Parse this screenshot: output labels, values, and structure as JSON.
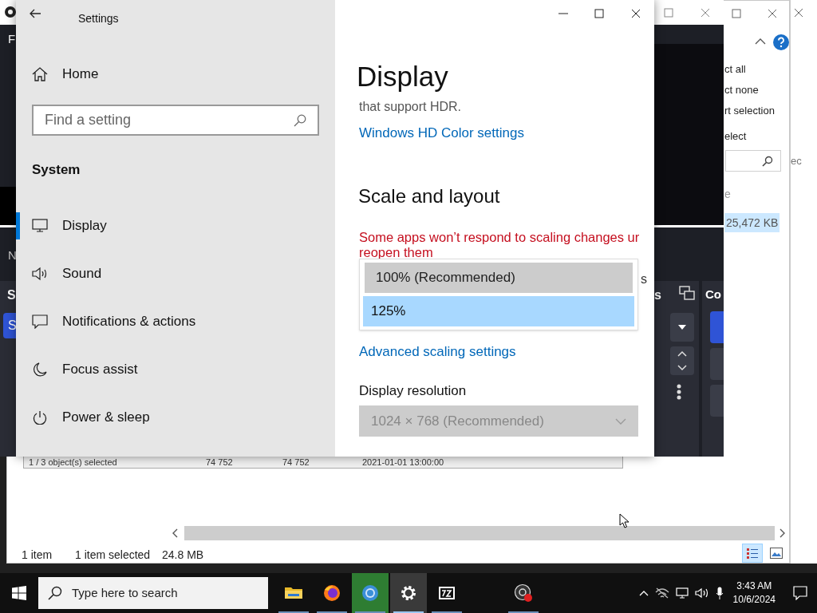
{
  "dark_window": {
    "menu_fragment": "F",
    "side_fragments": [
      "N",
      "S",
      "S"
    ],
    "panel_fragments": [
      "s",
      "Co"
    ]
  },
  "explorer_window": {
    "ribbon_items": [
      "ct all",
      "ct none",
      "rt selection",
      "elect"
    ],
    "list_fragment": "e",
    "size_cell": {
      "text": "25,472 KB",
      "selected": true
    },
    "inner_table": [
      "1 / 3 object(s) selected",
      "74 752",
      "74 752",
      "2021-01-01 13:00:00"
    ],
    "status_bar": {
      "count": "1 item",
      "selection": "1 item selected",
      "size": "24.8 MB"
    },
    "view_buttons": [
      {
        "kind": "details",
        "selected": true
      },
      {
        "kind": "thumbnails",
        "selected": false
      }
    ]
  },
  "edge_window": {
    "text_fragment": "ec"
  },
  "settings": {
    "title": "Settings",
    "home": "Home",
    "search": {
      "placeholder": "Find a setting"
    },
    "section": "System",
    "nav_items": [
      {
        "label": "Display",
        "selected": true
      },
      {
        "label": "Sound",
        "selected": false
      },
      {
        "label": "Notifications & actions",
        "selected": false
      },
      {
        "label": "Focus assist",
        "selected": false
      },
      {
        "label": "Power & sleep",
        "selected": false
      }
    ],
    "page_title": "Display",
    "hdr_text": "that support HDR.",
    "hdr_link": "Windows HD Color settings",
    "scale_heading": "Scale and layout",
    "warning": "Some apps won’t respond to scaling changes ur",
    "warning_line2": "reopen them",
    "covered_fragment": "s",
    "scale_options": [
      {
        "label": "100% (Recommended)",
        "selected": false,
        "hovered": true
      },
      {
        "label": "125%",
        "selected": true
      }
    ],
    "advanced_link": "Advanced scaling settings",
    "resolution_label": "Display resolution",
    "resolution_value": "1024 × 768 (Recommended)",
    "resolution_disabled": true
  },
  "taskbar": {
    "search_placeholder": "Type here to search",
    "apps": [
      {
        "kind": "folder",
        "selected": false
      },
      {
        "kind": "firefox",
        "selected": false
      },
      {
        "kind": "chrome",
        "selected": false
      },
      {
        "kind": "settings",
        "selected": true
      },
      {
        "kind": "archive",
        "selected": false
      },
      {
        "kind": "obs",
        "selected": false
      }
    ],
    "time": "3:43 AM",
    "date": "10/6/2024"
  }
}
